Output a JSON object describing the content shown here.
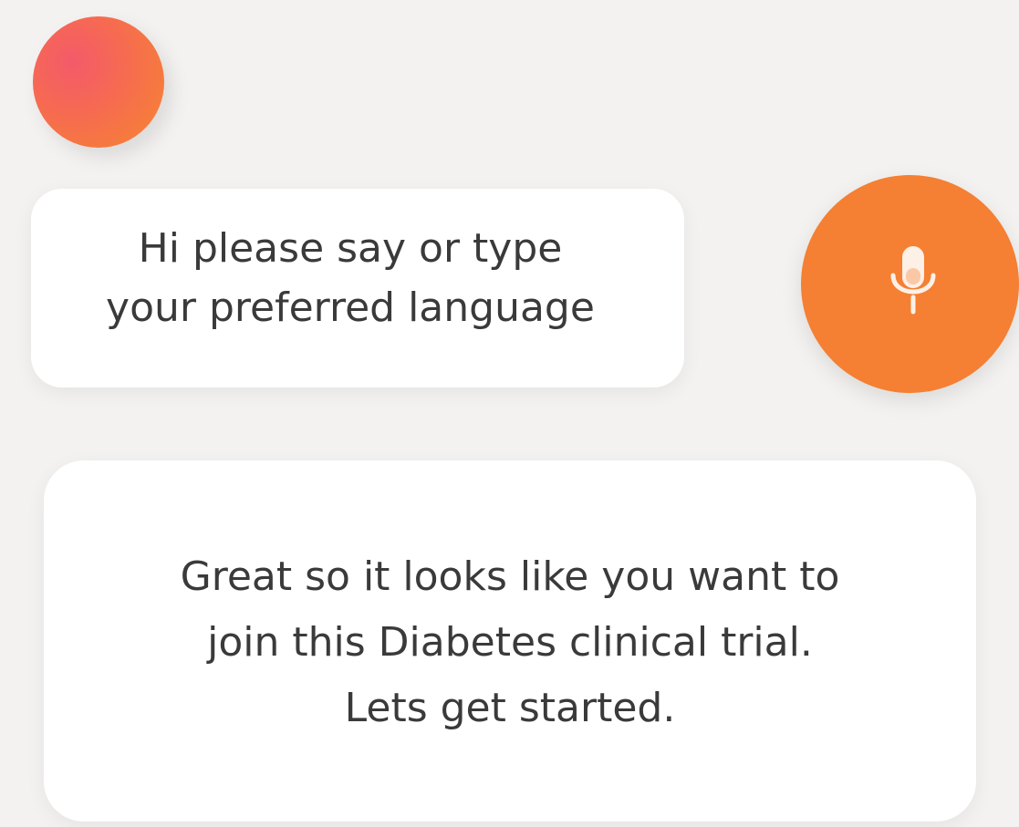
{
  "avatar": {
    "icon": "assistant-avatar-orb",
    "colors": [
      "#f45a6a",
      "#f66c4f",
      "#f7862f"
    ]
  },
  "assistant_message": {
    "lines": [
      "Hi please say or type",
      "your preferred language"
    ]
  },
  "mic_button": {
    "icon": "microphone-icon",
    "color": "#f57f32"
  },
  "reply_message": {
    "lines": [
      "Great so it looks like you want to",
      "join this Diabetes clinical trial.",
      "Lets get started."
    ]
  }
}
